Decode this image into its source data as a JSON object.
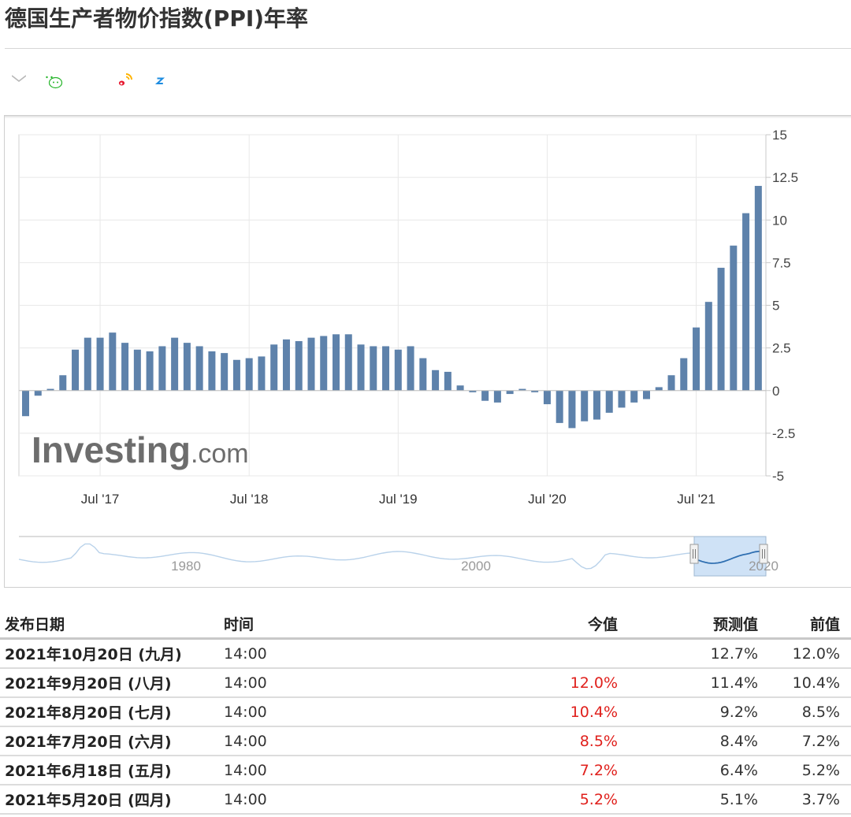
{
  "page": {
    "title": "德国生产者物价指数(PPI)年率"
  },
  "share": {
    "buttons": [
      {
        "name": "email-icon",
        "color": "#b7b7b7"
      },
      {
        "name": "wechat-icon",
        "color": "#26b52a"
      },
      {
        "name": "qq-icon",
        "color": "#111111"
      },
      {
        "name": "weibo-icon",
        "color": "#e6162d"
      },
      {
        "name": "qzone-icon",
        "color": "#1d8ce0"
      }
    ]
  },
  "chart_data": {
    "type": "bar",
    "x_start": "2017-01",
    "x_labels": [
      "Jul '17",
      "Jul '18",
      "Jul '19",
      "Jul '20",
      "Jul '21"
    ],
    "values": [
      -1.5,
      -0.3,
      0.1,
      0.9,
      2.4,
      3.1,
      3.1,
      3.4,
      2.8,
      2.4,
      2.3,
      2.6,
      3.1,
      2.8,
      2.6,
      2.3,
      2.2,
      1.8,
      1.9,
      2.0,
      2.7,
      3.0,
      2.9,
      3.1,
      3.2,
      3.3,
      3.3,
      2.7,
      2.6,
      2.6,
      2.4,
      2.6,
      1.9,
      1.2,
      1.1,
      0.3,
      -0.1,
      -0.6,
      -0.7,
      -0.2,
      0.1,
      -0.1,
      -0.8,
      -1.9,
      -2.2,
      -1.8,
      -1.7,
      -1.3,
      -1.0,
      -0.7,
      -0.5,
      0.2,
      0.9,
      1.9,
      3.7,
      5.2,
      7.2,
      8.5,
      10.4,
      12.0
    ],
    "ylim": [
      -5,
      15
    ],
    "yticks": [
      "15",
      "12.5",
      "10",
      "7.5",
      "5",
      "2.5",
      "0",
      "-2.5",
      "-5"
    ],
    "bar_color": "#5e82ab",
    "grid": true,
    "watermark": {
      "brand": "Investing",
      "suffix": ".com"
    },
    "navigator": {
      "labels": [
        "1980",
        "2000",
        "2020"
      ],
      "line_color": "#b9d2ea",
      "selected_color": "#2f6fb1",
      "mask_color": "#cfe2f6"
    }
  },
  "table": {
    "headers": {
      "date": "发布日期",
      "time": "时间",
      "actual": "今值",
      "forecast": "预测值",
      "previous": "前值"
    },
    "rows": [
      {
        "date": "2021年10月20日 (九月)",
        "time": "14:00",
        "actual": "",
        "forecast": "12.7%",
        "previous": "12.0%"
      },
      {
        "date": "2021年9月20日 (八月)",
        "time": "14:00",
        "actual": "12.0%",
        "forecast": "11.4%",
        "previous": "10.4%"
      },
      {
        "date": "2021年8月20日 (七月)",
        "time": "14:00",
        "actual": "10.4%",
        "forecast": "9.2%",
        "previous": "8.5%"
      },
      {
        "date": "2021年7月20日 (六月)",
        "time": "14:00",
        "actual": "8.5%",
        "forecast": "8.4%",
        "previous": "7.2%"
      },
      {
        "date": "2021年6月18日 (五月)",
        "time": "14:00",
        "actual": "7.2%",
        "forecast": "6.4%",
        "previous": "5.2%"
      },
      {
        "date": "2021年5月20日 (四月)",
        "time": "14:00",
        "actual": "5.2%",
        "forecast": "5.1%",
        "previous": "3.7%"
      }
    ]
  }
}
